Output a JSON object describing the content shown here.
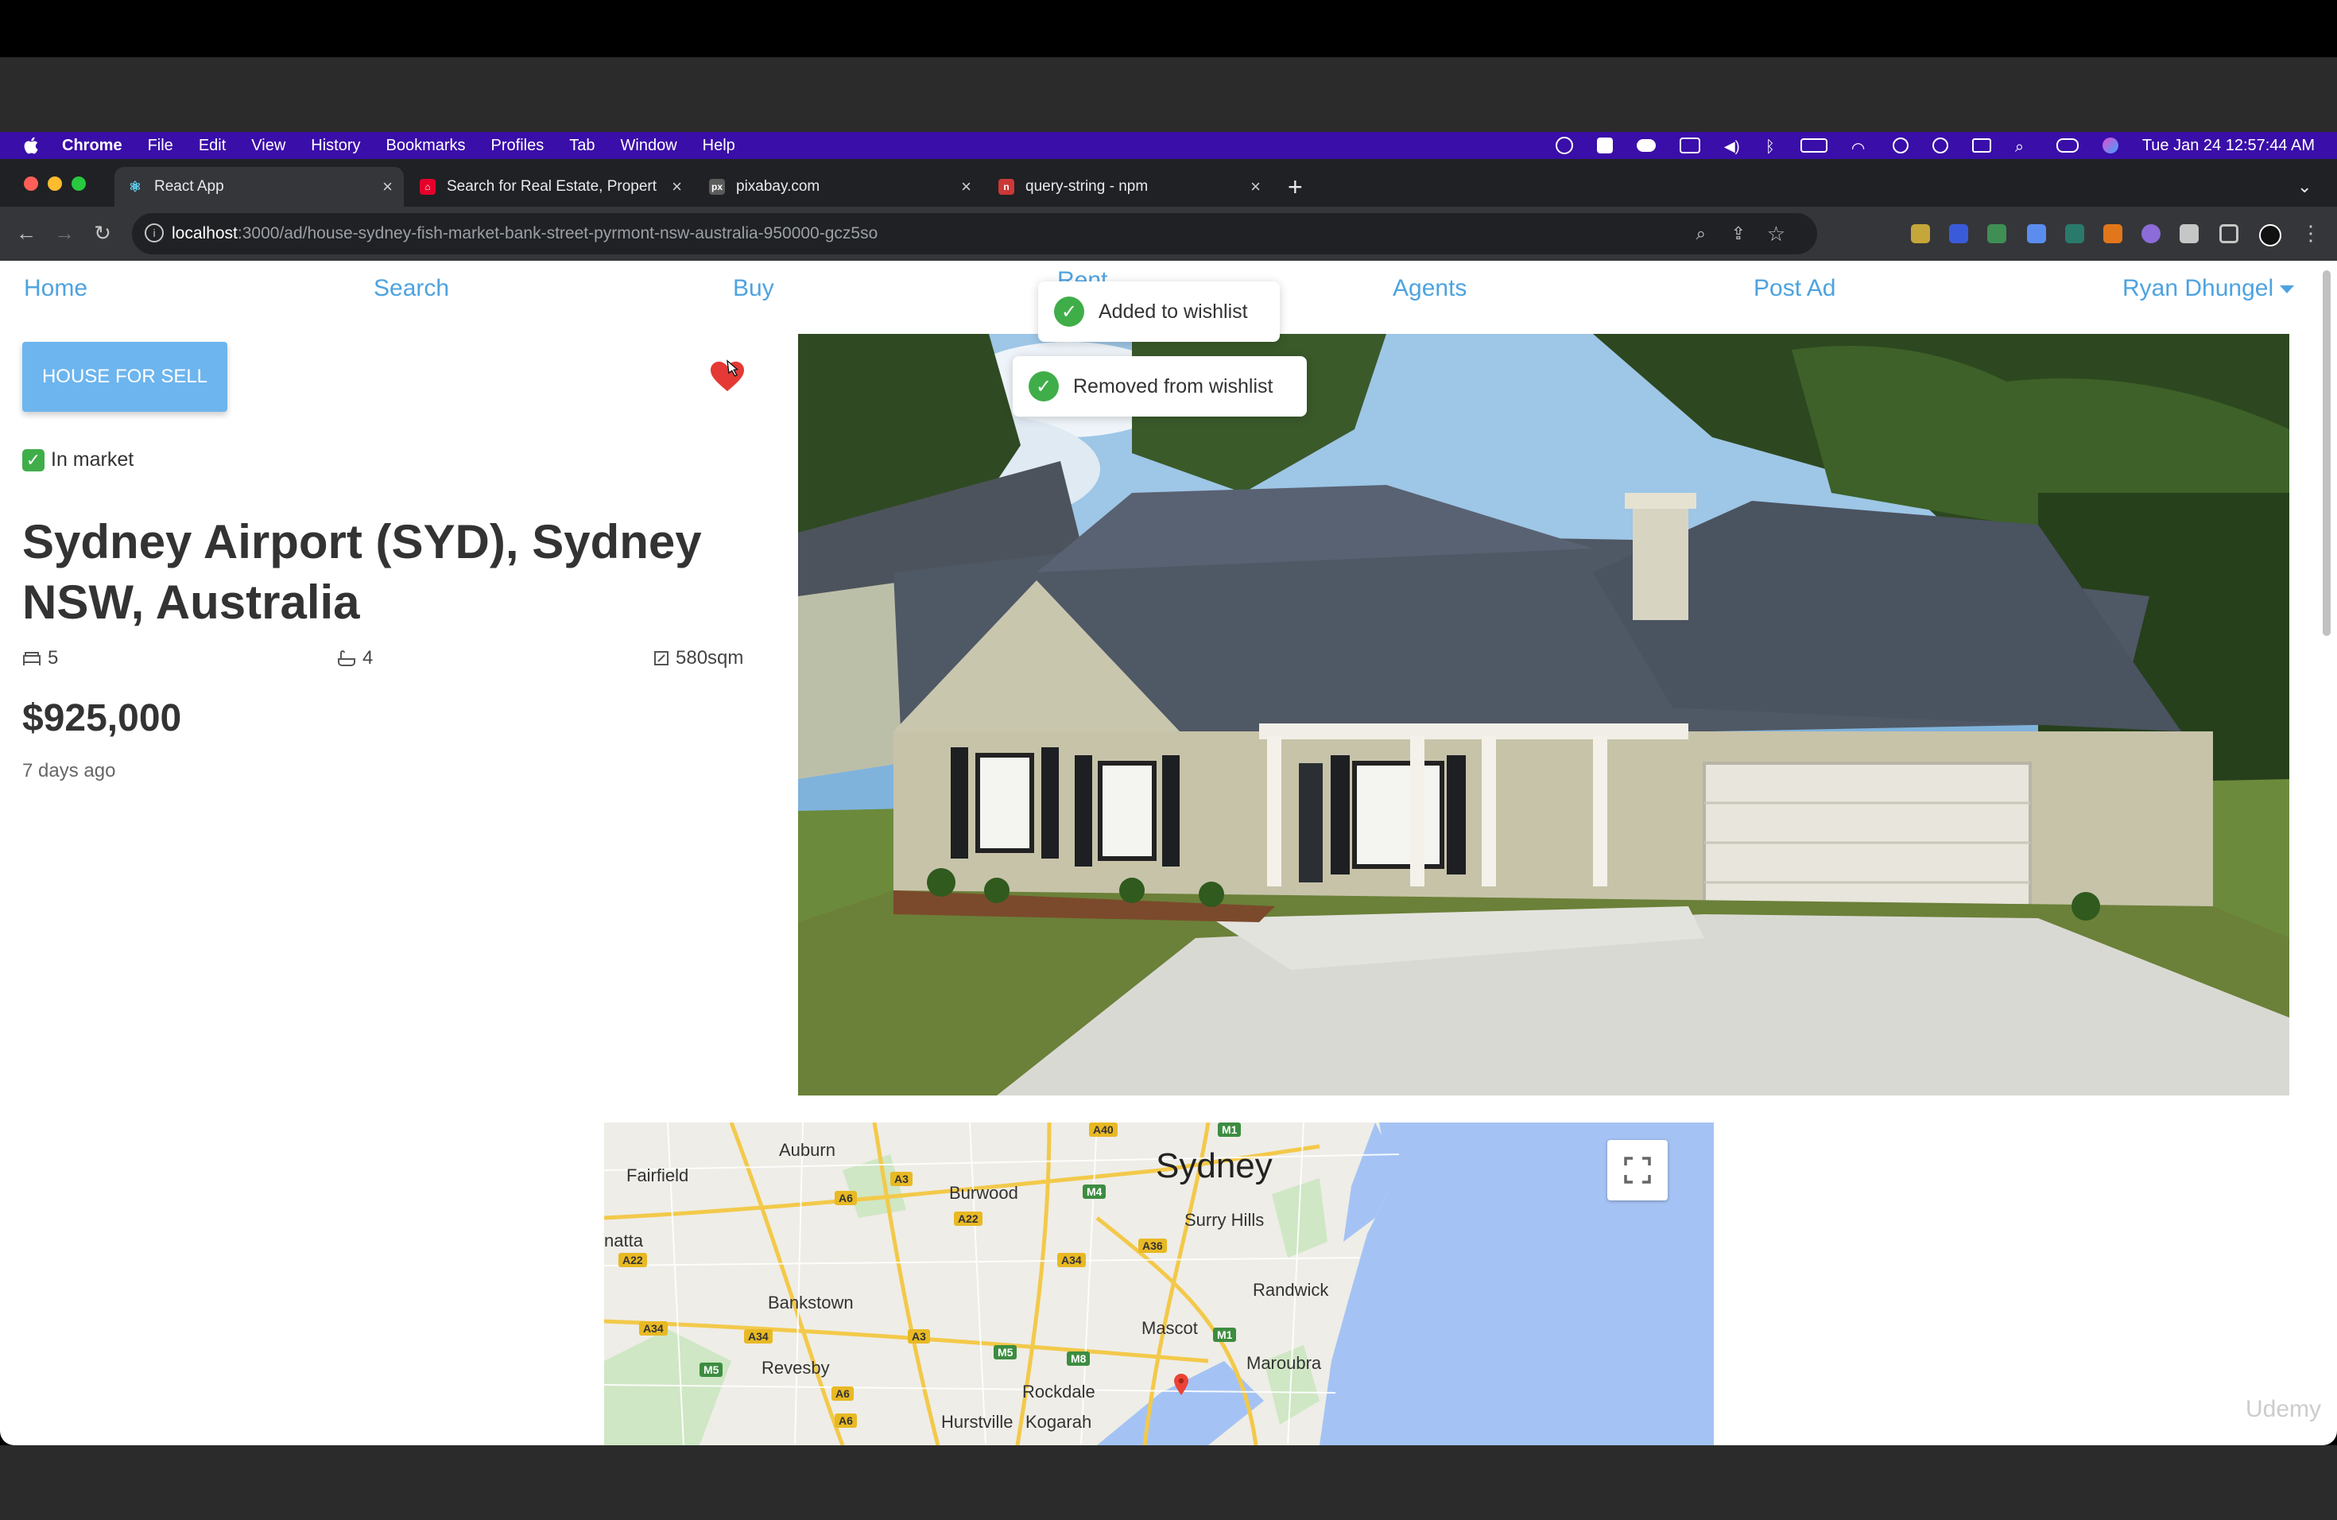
{
  "macos": {
    "app_name": "Chrome",
    "menu": [
      "File",
      "Edit",
      "View",
      "History",
      "Bookmarks",
      "Profiles",
      "Tab",
      "Window",
      "Help"
    ],
    "clock": "Tue Jan 24  12:57:44 AM"
  },
  "browser": {
    "tabs": [
      {
        "title": "React App",
        "favicon": "react-icon",
        "active": true
      },
      {
        "title": "Search for Real Estate, Propert",
        "favicon": "house-icon"
      },
      {
        "title": "pixabay.com",
        "favicon": "pixabay-icon"
      },
      {
        "title": "query-string - npm",
        "favicon": "npm-icon"
      }
    ],
    "url_host": "localhost",
    "url_path": ":3000/ad/house-sydney-fish-market-bank-street-pyrmont-nsw-australia-950000-gcz5so"
  },
  "nav": {
    "home": "Home",
    "search": "Search",
    "buy": "Buy",
    "rent": "Rent",
    "agents": "Agents",
    "post_ad": "Post Ad",
    "user": "Ryan Dhungel"
  },
  "listing": {
    "badge": "HOUSE FOR SELL",
    "status": "In market",
    "address": "Sydney Airport (SYD), Sydney NSW, Australia",
    "bedrooms": "5",
    "bathrooms": "4",
    "landsize": "580sqm",
    "price": "$925,000",
    "posted": "7 days ago",
    "wishlisted": true
  },
  "toasts": {
    "added": "Added to wishlist",
    "removed": "Removed from wishlist"
  },
  "map": {
    "city": "Sydney",
    "places": [
      "Auburn",
      "Fairfield",
      "Burwood",
      "Surry Hills",
      "Randwick",
      "Bankstown",
      "Mascot",
      "Maroubra",
      "Revesby",
      "Rockdale",
      "Hurstville",
      "Kogarah",
      "natta"
    ],
    "routes": [
      "A40",
      "M1",
      "A6",
      "A3",
      "M4",
      "A22",
      "A36",
      "A34",
      "A22",
      "A34",
      "A34",
      "A3",
      "M5",
      "M5",
      "M8",
      "M1",
      "A6",
      "A6"
    ]
  },
  "watermark": "Udemy",
  "colors": {
    "link": "#4da3e0",
    "badge": "#6db5ee",
    "success": "#3fae49",
    "menubar": "#3a0ea8"
  }
}
